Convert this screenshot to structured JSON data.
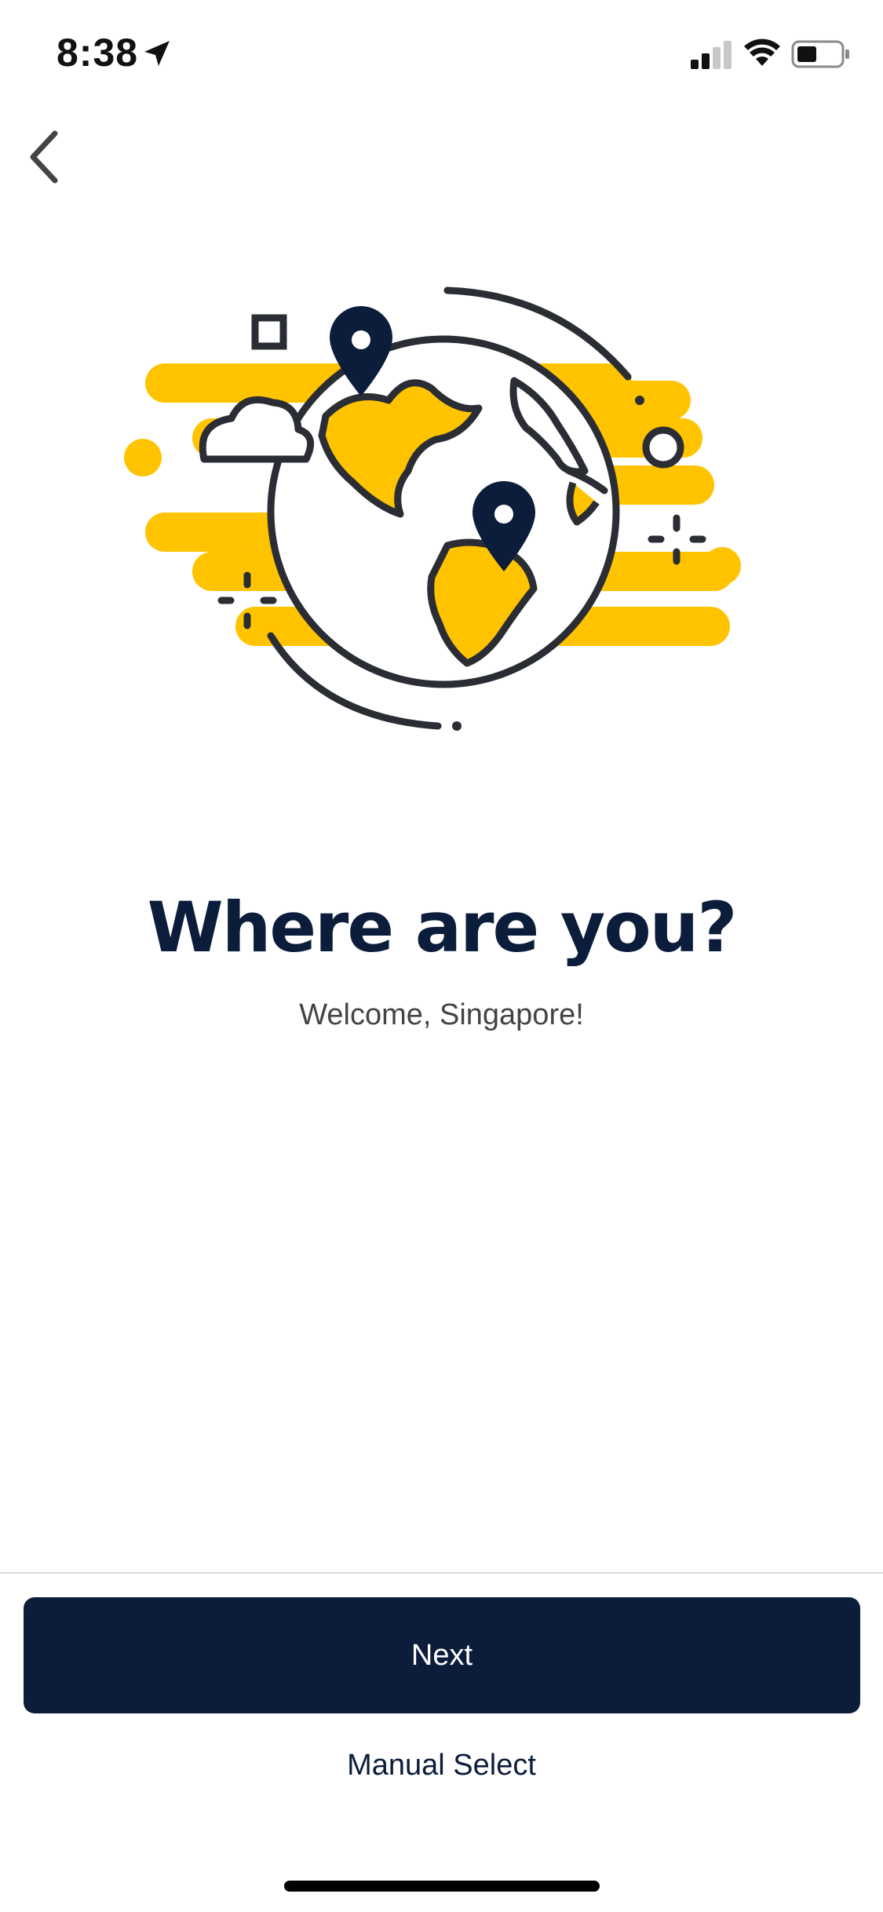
{
  "status_bar": {
    "time": "8:38",
    "icons": [
      "location-arrow-icon",
      "cellular-signal-icon",
      "wifi-icon",
      "battery-icon"
    ]
  },
  "navigation": {
    "back_icon": "chevron-left-icon"
  },
  "illustration": {
    "name": "globe-with-location-pins",
    "colors": {
      "accent": "#ffc300",
      "outline": "#2a2d34",
      "pin": "#0c1d3c"
    }
  },
  "content": {
    "title": "Where are you?",
    "subtitle": "Welcome, Singapore!"
  },
  "actions": {
    "next_label": "Next",
    "manual_select_label": "Manual Select"
  },
  "colors": {
    "primary": "#0c1d3c",
    "background": "#ffffff",
    "divider": "#d9d9d9"
  }
}
